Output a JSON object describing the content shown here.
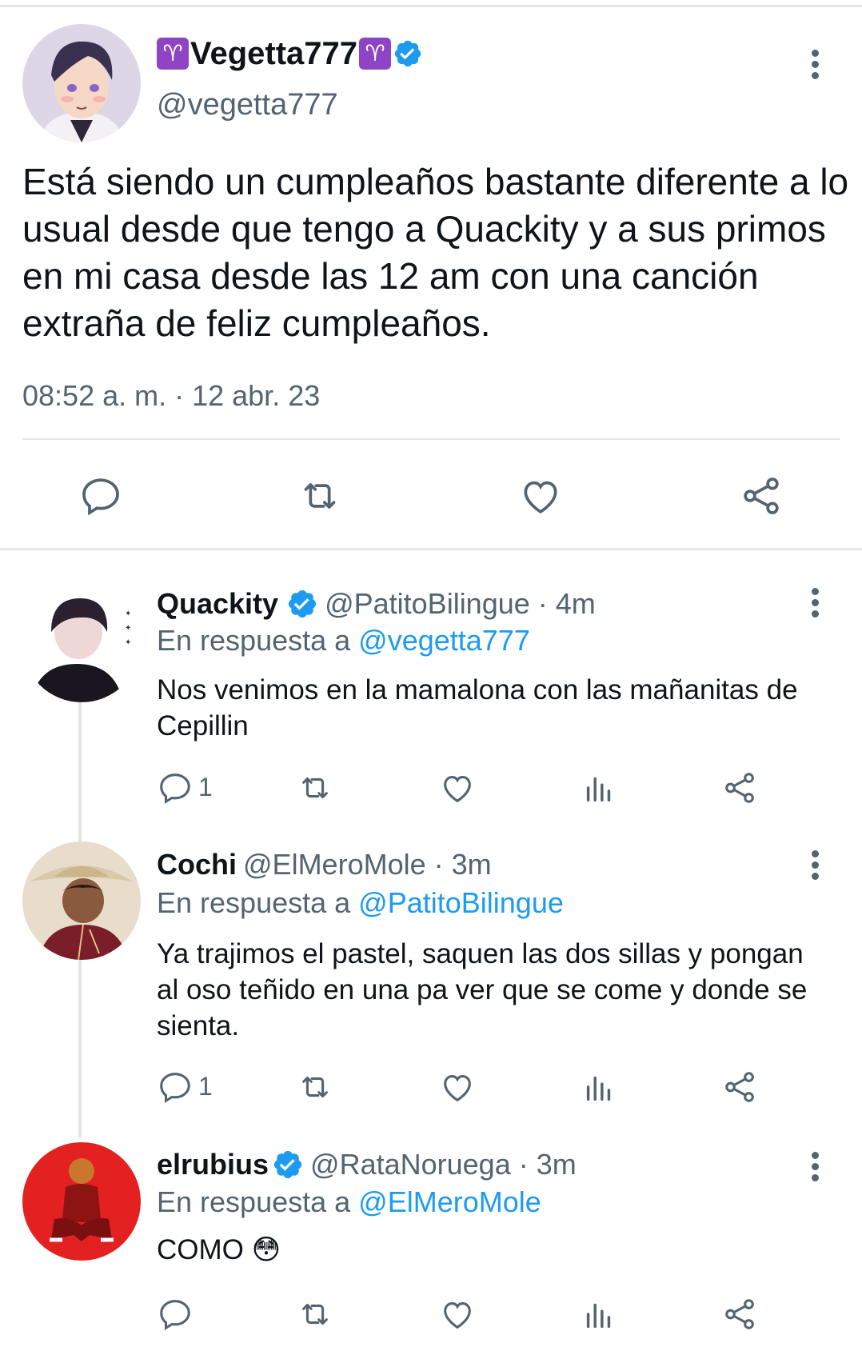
{
  "main_tweet": {
    "display_name_emoji_left": "♈",
    "display_name": "Vegetta777",
    "display_name_emoji_right": "♈",
    "handle": "@vegetta777",
    "text": "Está siendo un cumpleaños bastante diferente a lo usual desde que tengo a Quackity y a sus primos en mi casa desde las 12 am con una canción extraña de feliz cumpleaños.",
    "timestamp": "08:52 a. m. · 12 abr. 23",
    "actions": [
      "reply-icon",
      "retweet-icon",
      "like-icon",
      "share-icon"
    ]
  },
  "replies": [
    {
      "name": "Quackity",
      "verified": true,
      "handle": "@PatitoBilingue · 4m",
      "reply_prefix": "En respuesta a ",
      "reply_to": "@vegetta777",
      "text": "Nos venimos en la mamalona con las mañanitas de Cepillin",
      "reply_count": "1"
    },
    {
      "name": "Cochi",
      "verified": false,
      "handle": "@ElMeroMole · 3m",
      "reply_prefix": "En respuesta a ",
      "reply_to": "@PatitoBilingue",
      "text": "Ya trajimos el pastel, saquen las dos sillas y pongan al oso teñido en una pa ver que se come y donde se sienta.",
      "reply_count": "1"
    },
    {
      "name": "elrubius",
      "verified": true,
      "handle": "@RataNoruega · 3m",
      "reply_prefix": "En respuesta a ",
      "reply_to": "@ElMeroMole",
      "text": "COMO 😳",
      "reply_count": ""
    }
  ],
  "colors": {
    "text": "#0f1419",
    "secondary": "#536471",
    "link": "#1d9bf0",
    "verified": "#1d9bf0",
    "divider": "#e6e6e6"
  }
}
